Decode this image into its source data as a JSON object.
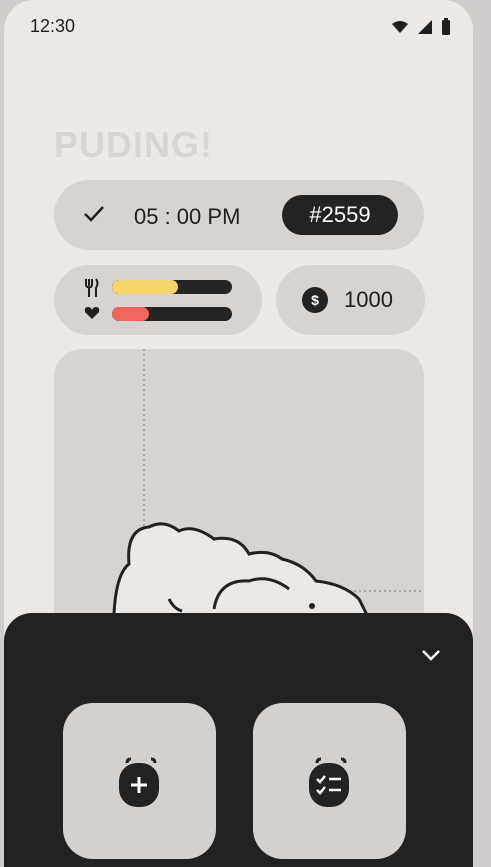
{
  "status_bar": {
    "time": "12:30"
  },
  "app": {
    "title": "PUDING!"
  },
  "schedule": {
    "time": "05 : 00 PM",
    "id_badge": "#2559"
  },
  "stats": {
    "hunger": 0.55,
    "health": 0.31,
    "hunger_color": "#f7d56b",
    "health_color": "#f0655c"
  },
  "wallet": {
    "currency_symbol": "$",
    "amount": "1000"
  },
  "sheet": {
    "actions": [
      "plus-action",
      "checklist-action"
    ]
  }
}
